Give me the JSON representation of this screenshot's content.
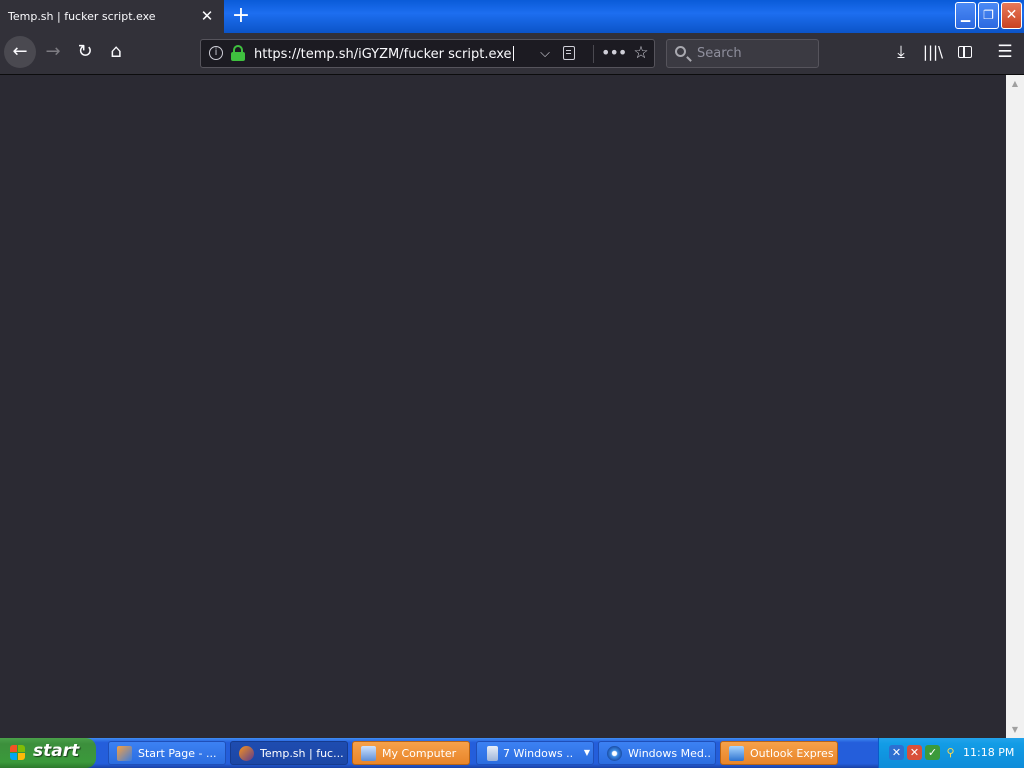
{
  "browser": {
    "tab": {
      "title": "Temp.sh | fucker script.exe",
      "close_glyph": "✕"
    },
    "new_tab_glyph": "+",
    "window_controls": {
      "minimize": "▁",
      "maximize": "❐",
      "close": "✕"
    },
    "nav": {
      "back_glyph": "←",
      "forward_glyph": "→",
      "reload_glyph": "↻",
      "home_glyph": "⌂"
    },
    "urlbar": {
      "info_glyph": "i",
      "url": "https://temp.sh/iGYZM/fucker script.exe",
      "dropdown_glyph": "⌵",
      "more_glyph": "•••",
      "bookmark_glyph": "☆"
    },
    "search": {
      "placeholder": "Search"
    },
    "toolbar": {
      "downloads_glyph": "⤓",
      "library_glyph": "|||\\",
      "menu_glyph": "☰"
    },
    "scrollbar": {
      "up_glyph": "▲",
      "down_glyph": "▼"
    }
  },
  "taskbar": {
    "start_label": "start",
    "tasks": [
      {
        "label": "Start Page - ...",
        "icon": "start-page-icon"
      },
      {
        "label": "Temp.sh | fuc...",
        "icon": "firefox-icon"
      },
      {
        "label": "My Computer",
        "icon": "my-computer-icon"
      },
      {
        "label": "7 Windows ...",
        "icon": "windows-explorer-icon"
      },
      {
        "label": "Windows Med...",
        "icon": "windows-media-player-icon"
      },
      {
        "label": "Outlook Express",
        "icon": "outlook-express-icon"
      }
    ],
    "clock": "11:18 PM"
  },
  "colors": {
    "content_background": "#2b2a33",
    "toolbar_background": "#323139",
    "taskbar_blue": "#245edb",
    "start_green": "#3c8f3c",
    "warning_orange": "#e8852a",
    "lock_green": "#3fc13f"
  }
}
